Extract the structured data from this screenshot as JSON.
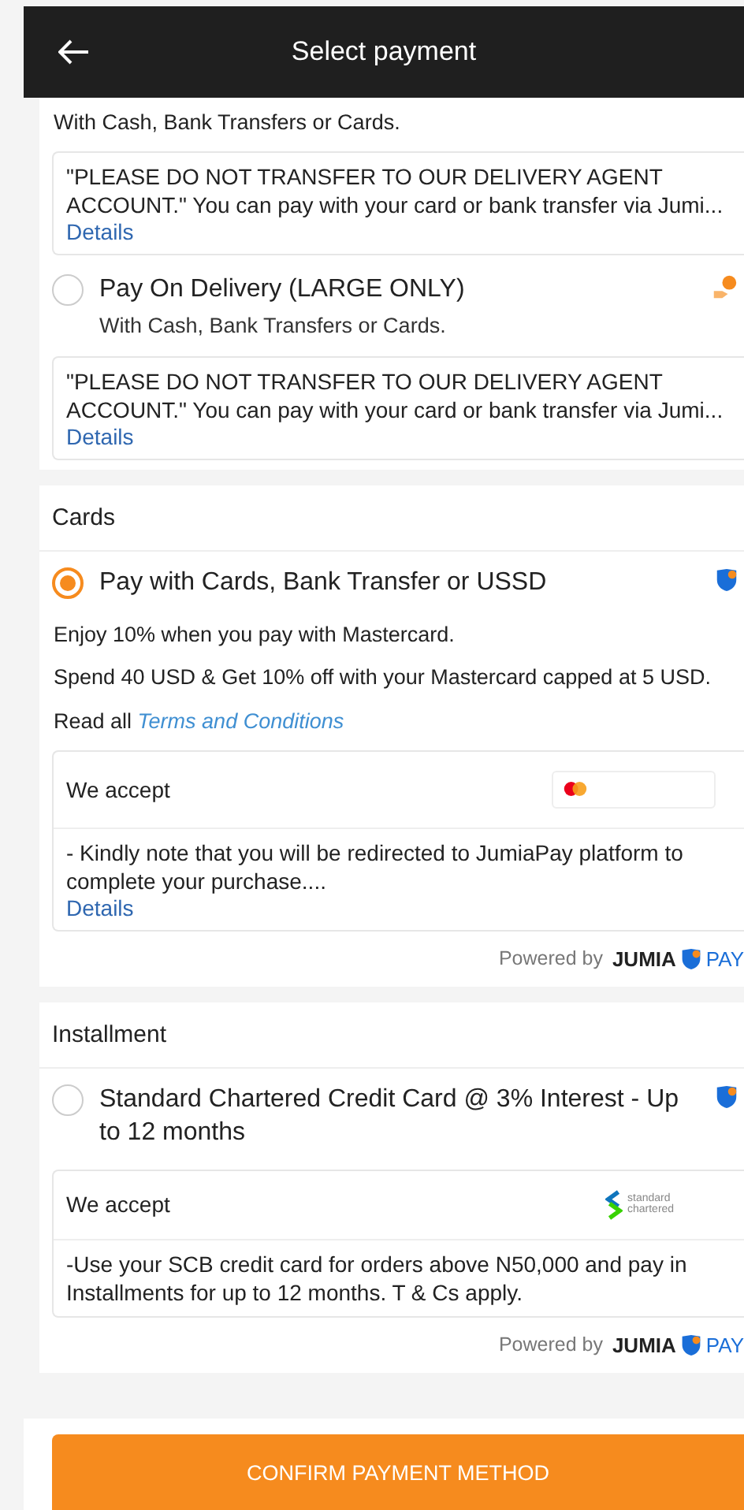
{
  "header": {
    "title": "Select payment"
  },
  "sections": [
    {
      "items": [
        {
          "kind": "text",
          "text": "With Cash, Bank Transfers or Cards."
        },
        {
          "kind": "note",
          "text": "\"PLEASE DO NOT TRANSFER TO OUR DELIVERY AGENT ACCOUNT.\" You can pay with your card or bank transfer via Jumi...",
          "link": "Details"
        },
        {
          "kind": "option",
          "label": "Pay On Delivery (LARGE ONLY)",
          "subtitle": "With Cash, Bank Transfers or Cards.",
          "selected": false
        },
        {
          "kind": "note",
          "text": "\"PLEASE DO NOT TRANSFER TO OUR DELIVERY AGENT ACCOUNT.\"  You can pay with your card or bank transfer via Jumi...",
          "link": "Details"
        }
      ]
    },
    {
      "title": "Cards",
      "items": [
        {
          "kind": "option",
          "label": "Pay with Cards, Bank Transfer or USSD",
          "selected": true
        },
        {
          "kind": "text",
          "text": "Enjoy 10% when you pay with Mastercard."
        },
        {
          "kind": "text",
          "text": "Spend 40 USD & Get 10% off with your Mastercard capped at 5 USD."
        },
        {
          "kind": "terms",
          "text": "Read all",
          "link": "Terms and Conditions"
        },
        {
          "kind": "accept",
          "label": "We accept",
          "note": "- Kindly note that you will be redirected to JumiaPay platform to complete your purchase....",
          "link": "Details"
        }
      ],
      "powered": {
        "label": "Powered by",
        "brand": "JUMIA",
        "brand_suffix": "PAY"
      }
    },
    {
      "title": "Installment",
      "items": [
        {
          "kind": "option",
          "label": "Standard Chartered Credit Card @ 3% Interest - Up to 12 months",
          "selected": false
        },
        {
          "kind": "accept",
          "label": "We accept",
          "logo_text": "standard chartered",
          "note": "-Use your SCB credit card for orders above N50,000 and pay in Installments for up to 12 months. T & Cs apply."
        }
      ],
      "powered": {
        "label": "Powered by",
        "brand": "JUMIA",
        "brand_suffix": "PAY"
      }
    }
  ],
  "confirm_button": "CONFIRM PAYMENT METHOD"
}
